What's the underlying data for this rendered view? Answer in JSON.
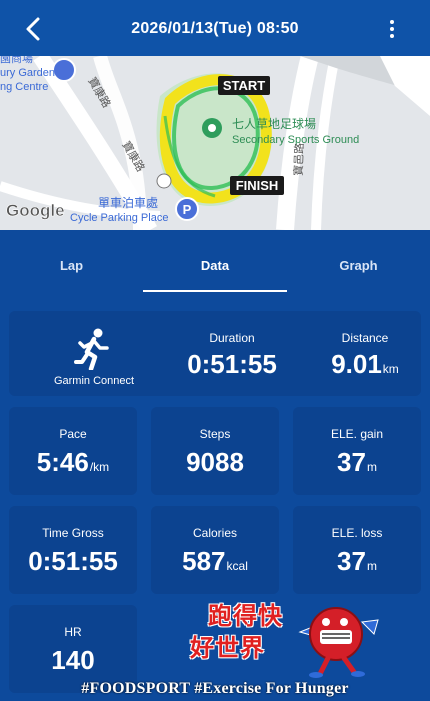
{
  "header": {
    "title": "2026/01/13(Tue) 08:50",
    "back_icon": "chevron-left-icon",
    "more_icon": "more-vertical-icon"
  },
  "map": {
    "labels": {
      "start": "START",
      "finish": "FINISH",
      "venue_zh": "七人草地足球場",
      "venue_en": "Secondary Sports Ground",
      "cycle_zh": "單車泊車處",
      "cycle_en": "Cycle Parking Place",
      "street_1": "寶康路",
      "street_2": "寶康路",
      "street_3": "寶邑路",
      "garden_zh": "園商場",
      "garden_en_1": "ury Garden",
      "garden_en_2": "ng Centre",
      "google": "Google"
    }
  },
  "tabs": [
    {
      "label": "Lap",
      "active": false
    },
    {
      "label": "Data",
      "active": true
    },
    {
      "label": "Graph",
      "active": false
    }
  ],
  "cards": {
    "source": {
      "label": "Garmin Connect"
    },
    "duration": {
      "label": "Duration",
      "value": "0:51:55"
    },
    "distance": {
      "label": "Distance",
      "value": "9.01",
      "unit": "km"
    },
    "pace": {
      "label": "Pace",
      "value": "5:46",
      "unit": "/km"
    },
    "steps": {
      "label": "Steps",
      "value": "9088"
    },
    "ele_gain": {
      "label": "ELE. gain",
      "value": "37",
      "unit": "m"
    },
    "time_gross": {
      "label": "Time Gross",
      "value": "0:51:55"
    },
    "calories": {
      "label": "Calories",
      "value": "587",
      "unit": "kcal"
    },
    "ele_loss": {
      "label": "ELE. loss",
      "value": "37",
      "unit": "m"
    },
    "hr": {
      "label": "HR",
      "value": "140"
    }
  },
  "watermark": {
    "logo_line1": "跑得快",
    "logo_line2": "好世界",
    "hashtag": "#FOODSPORT #Exercise For Hunger"
  },
  "colors": {
    "background": "#0d4a9c",
    "card": "#0c4390",
    "header": "#0f53a8",
    "route_yellow": "#f2e21c",
    "route_green": "#2fbf56"
  }
}
